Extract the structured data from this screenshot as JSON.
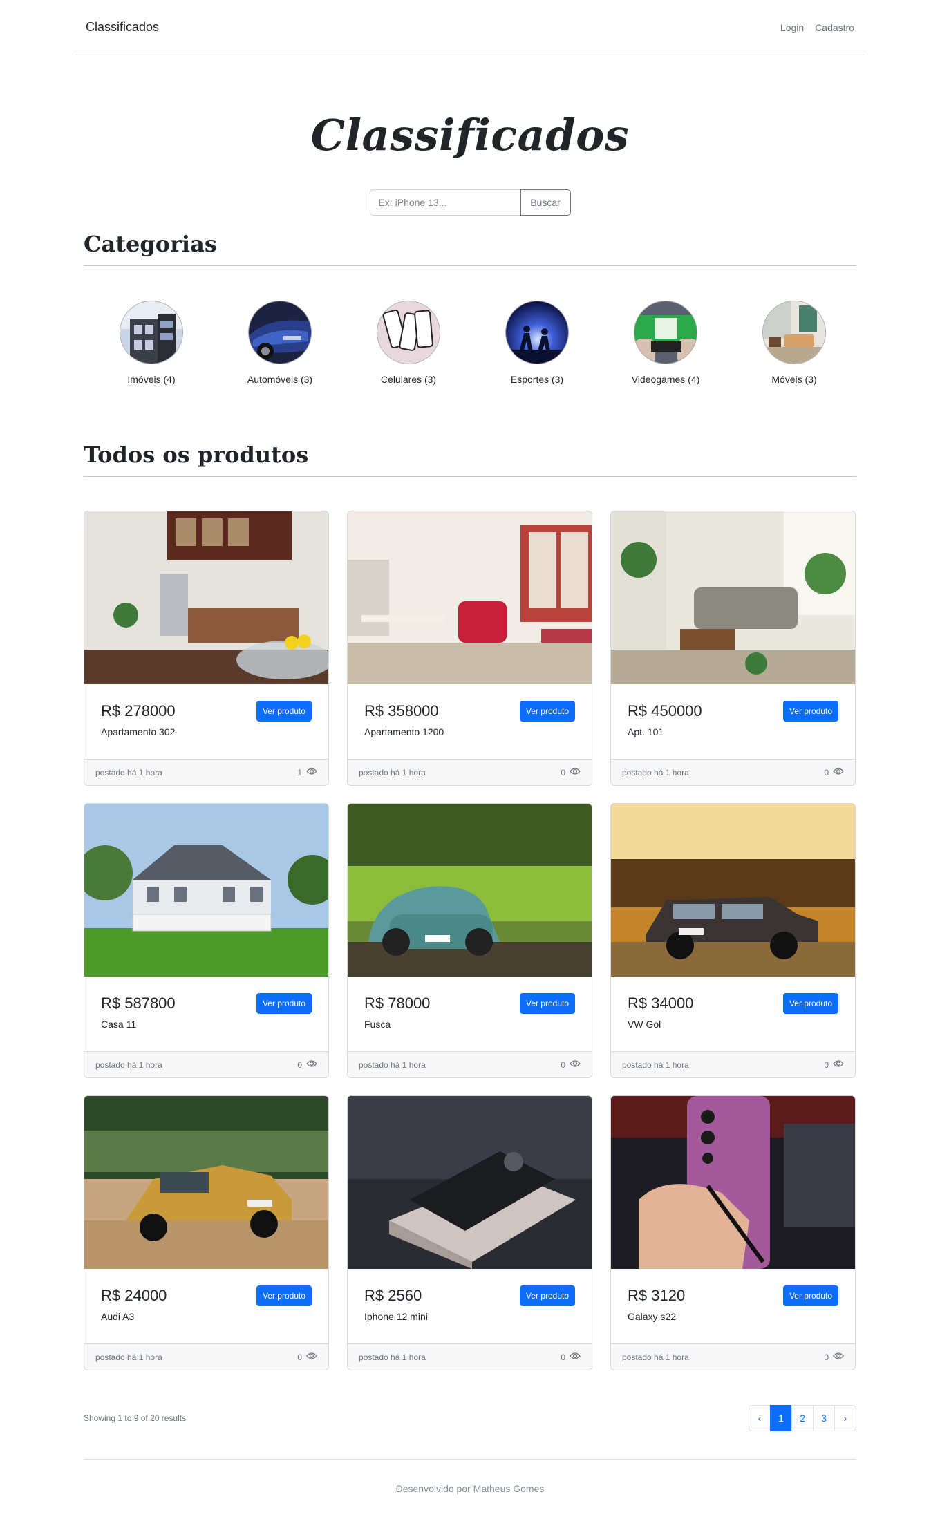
{
  "navbar": {
    "brand": "Classificados",
    "login": "Login",
    "signup": "Cadastro"
  },
  "hero": {
    "title": "Classificados"
  },
  "search": {
    "placeholder": "Ex: iPhone 13...",
    "value": "",
    "button": "Buscar"
  },
  "categories": {
    "title": "Categorias",
    "items": [
      {
        "label": "Imóveis (4)"
      },
      {
        "label": "Automóveis (3)"
      },
      {
        "label": "Celulares (3)"
      },
      {
        "label": "Esportes (3)"
      },
      {
        "label": "Videogames (4)"
      },
      {
        "label": "Móveis (3)"
      }
    ]
  },
  "products": {
    "title": "Todos os produtos",
    "view_button": "Ver produto",
    "items": [
      {
        "price": "R$ 278000",
        "name": "Apartamento 302",
        "posted": "postado há 1 hora",
        "views": "1"
      },
      {
        "price": "R$ 358000",
        "name": "Apartamento 1200",
        "posted": "postado há 1 hora",
        "views": "0"
      },
      {
        "price": "R$ 450000",
        "name": "Apt. 101",
        "posted": "postado há 1 hora",
        "views": "0"
      },
      {
        "price": "R$ 587800",
        "name": "Casa 11",
        "posted": "postado há 1 hora",
        "views": "0"
      },
      {
        "price": "R$ 78000",
        "name": "Fusca",
        "posted": "postado há 1 hora",
        "views": "0"
      },
      {
        "price": "R$ 34000",
        "name": "VW Gol",
        "posted": "postado há 1 hora",
        "views": "0"
      },
      {
        "price": "R$ 24000",
        "name": "Audi A3",
        "posted": "postado há 1 hora",
        "views": "0"
      },
      {
        "price": "R$ 2560",
        "name": "Iphone 12 mini",
        "posted": "postado há 1 hora",
        "views": "0"
      },
      {
        "price": "R$ 3120",
        "name": "Galaxy s22",
        "posted": "postado há 1 hora",
        "views": "0"
      }
    ]
  },
  "pagination": {
    "results": "Showing 1 to 9 of 20 results",
    "prev": "‹",
    "pages": [
      "1",
      "2",
      "3"
    ],
    "active": "1",
    "next": "›"
  },
  "footer": {
    "text": "Desenvolvido por Matheus Gomes"
  },
  "colors": {
    "primary": "#0d6efd",
    "muted": "#6c757d"
  }
}
